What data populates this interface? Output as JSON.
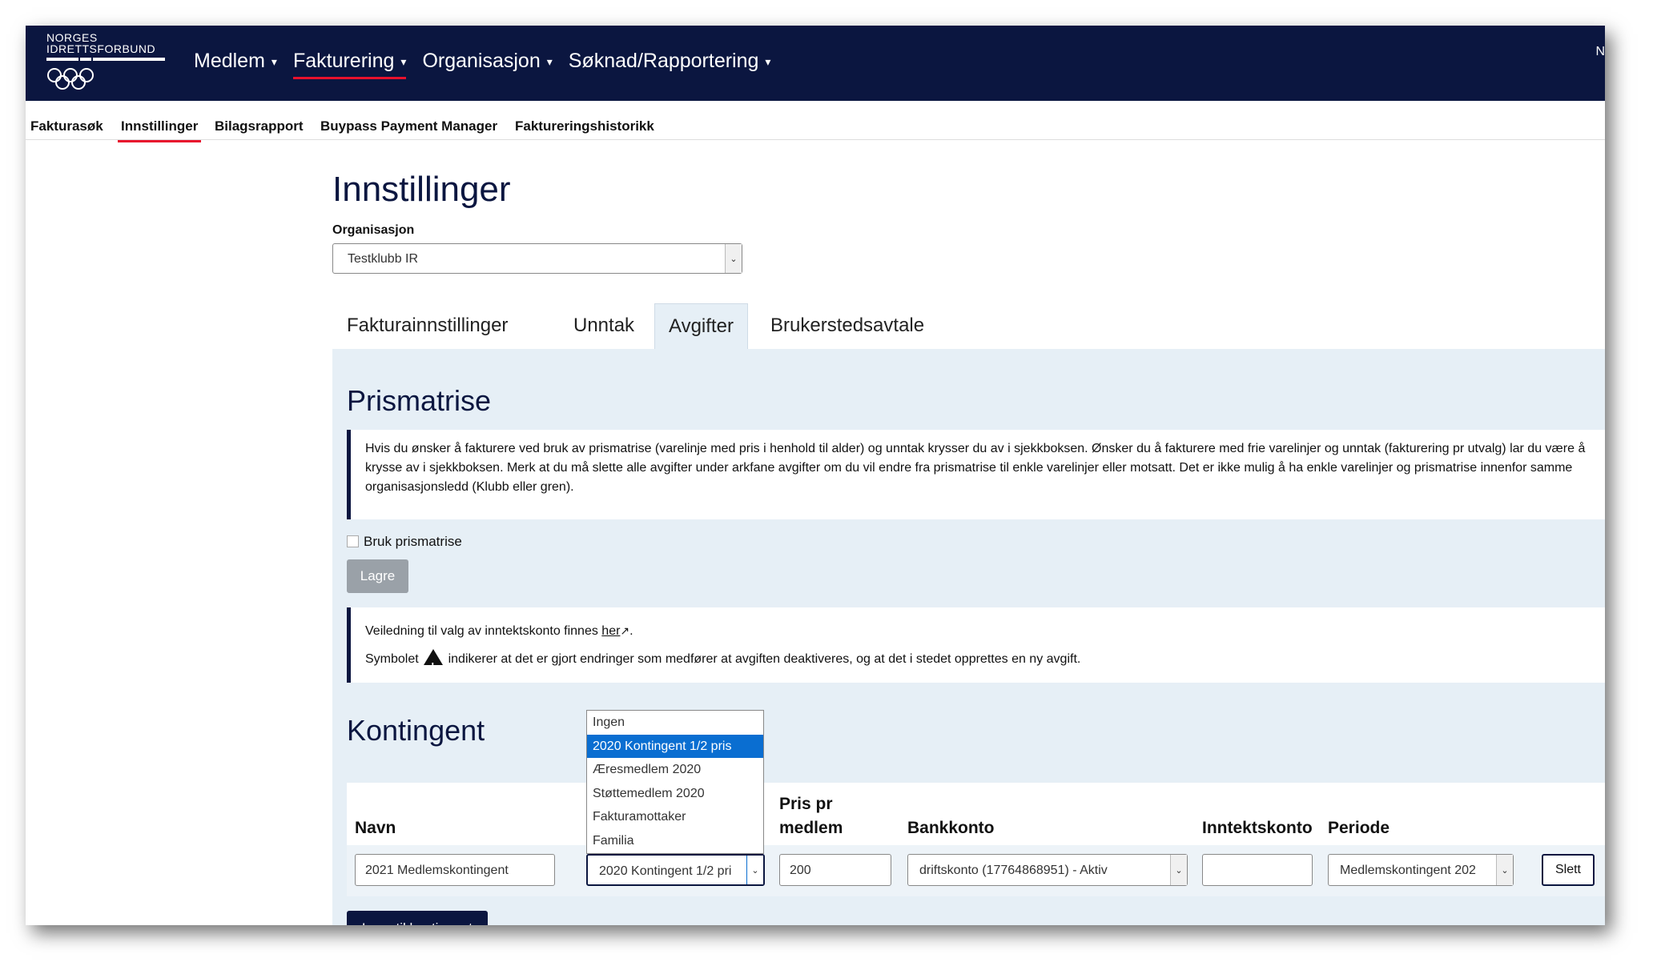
{
  "logo": {
    "line1": "NORGES",
    "line2": "IDRETTSFORBUND"
  },
  "main_nav": [
    {
      "label": "Medlem"
    },
    {
      "label": "Fakturering"
    },
    {
      "label": "Organisasjon"
    },
    {
      "label": "Søknad/Rapportering"
    }
  ],
  "topbar_edge_text": "N",
  "sub_nav": [
    {
      "label": "Fakturasøk"
    },
    {
      "label": "Innstillinger"
    },
    {
      "label": "Bilagsrapport"
    },
    {
      "label": "Buypass Payment Manager"
    },
    {
      "label": "Faktureringshistorikk"
    }
  ],
  "page": {
    "title": "Innstillinger"
  },
  "organisation": {
    "label": "Organisasjon",
    "value": "Testklubb IR"
  },
  "tabs": [
    {
      "label": "Fakturainnstillinger"
    },
    {
      "label": "Unntak"
    },
    {
      "label": "Avgifter"
    },
    {
      "label": "Brukerstedsavtale"
    }
  ],
  "prismatrise": {
    "title": "Prismatrise",
    "info": "Hvis du ønsker å fakturere ved bruk av prismatrise (varelinje med pris i henhold til alder) og unntak krysser du av i sjekkboksen. Ønsker du å fakturere med frie varelinjer og unntak (fakturering pr utvalg) lar du være å krysse av i sjekkboksen. Merk at du må slette alle avgifter under arkfane avgifter om du vil endre fra prismatrise til enkle varelinjer eller motsatt. Det er ikke mulig å ha enkle varelinjer og prismatrise innenfor samme organisasjonsledd (Klubb eller gren).",
    "checkbox_label": "Bruk prismatrise",
    "save_label": "Lagre"
  },
  "guidance": {
    "line1_prefix": "Veiledning til valg av inntektskonto finnes ",
    "line1_link": "her",
    "line1_suffix": ".",
    "line2_prefix": "Symbolet ",
    "line2_suffix": " indikerer at det er gjort endringer som medfører at avgiften deaktiveres, og at det i stedet opprettes en ny avgift."
  },
  "kontingent": {
    "title": "Kontingent",
    "headers": {
      "navn": "Navn",
      "pris_line1": "Pris pr",
      "pris_line2": "medlem",
      "bankkonto": "Bankkonto",
      "inntektskonto": "Inntektskonto",
      "periode": "Periode"
    },
    "row": {
      "navn": "2021 Medlemskontingent",
      "type": "2020 Kontingent 1/2 pri",
      "pris": "200",
      "bankkonto": "driftskonto (17764868951) - Aktiv",
      "inntektskonto": "",
      "periode": "Medlemskontingent 202",
      "delete_label": "Slett"
    },
    "add_label": "Legg til kontingent"
  },
  "dropdown": {
    "options": [
      "Ingen",
      "2020 Kontingent 1/2 pris",
      "Æresmedlem 2020",
      "Støttemedlem 2020",
      "Fakturamottaker",
      "Familia"
    ],
    "selected_index": 1
  },
  "colors": {
    "navy": "#0b1640",
    "accent_red": "#e8112d",
    "panel": "#e6eff6",
    "highlight": "#0a6ed1"
  }
}
